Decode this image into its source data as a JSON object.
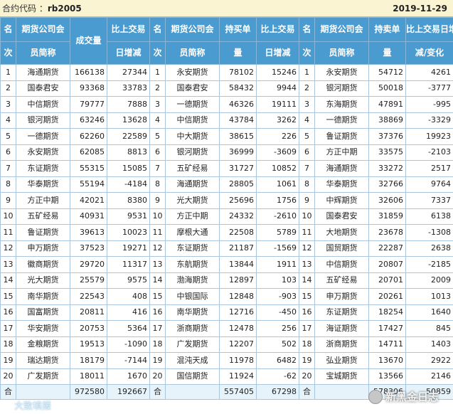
{
  "header": {
    "contract_label": "合约代码",
    "contract_code": "rb2005",
    "date": "2019-11-29"
  },
  "columns": {
    "rank": "名次",
    "member": "期货公司会员简称",
    "volume": "成交量",
    "volume_change": "比上交易日增减",
    "long_qty": "持买单量",
    "long_change": "比上交易日增减",
    "short_qty": "持卖单量",
    "short_change": "比上交易日增减/变化"
  },
  "rows": [
    [
      "1",
      "海通期货",
      "166138",
      "27344",
      "1",
      "永安期货",
      "78102",
      "15246",
      "1",
      "永安期货",
      "54712",
      "4261"
    ],
    [
      "2",
      "国泰君安",
      "93368",
      "33783",
      "2",
      "国泰君安",
      "58432",
      "9944",
      "2",
      "银河期货",
      "50018",
      "-3777"
    ],
    [
      "3",
      "中信期货",
      "79777",
      "7888",
      "3",
      "一德期货",
      "46326",
      "19111",
      "3",
      "东海期货",
      "47891",
      "-995"
    ],
    [
      "4",
      "银河期货",
      "63246",
      "13628",
      "4",
      "中信期货",
      "43784",
      "3262",
      "4",
      "一德期货",
      "38869",
      "-3329"
    ],
    [
      "5",
      "一德期货",
      "62260",
      "22589",
      "5",
      "中大期货",
      "38615",
      "226",
      "5",
      "鲁证期货",
      "37376",
      "19923"
    ],
    [
      "6",
      "永安期货",
      "62085",
      "8813",
      "6",
      "银河期货",
      "36999",
      "-3609",
      "6",
      "方正中期",
      "33575",
      "-2103"
    ],
    [
      "7",
      "东证期货",
      "55315",
      "15085",
      "7",
      "五矿经易",
      "31727",
      "10852",
      "7",
      "海通期货",
      "33272",
      "2517"
    ],
    [
      "8",
      "华泰期货",
      "55194",
      "-4184",
      "8",
      "海通期货",
      "28805",
      "1061",
      "8",
      "华泰期货",
      "32766",
      "9764"
    ],
    [
      "9",
      "方正中期",
      "42021",
      "8380",
      "9",
      "光大期货",
      "25696",
      "1756",
      "9",
      "中辉期货",
      "32606",
      "7337"
    ],
    [
      "10",
      "五矿经易",
      "40931",
      "9531",
      "10",
      "方正中期",
      "24332",
      "-2610",
      "10",
      "国泰君安",
      "31859",
      "6138"
    ],
    [
      "11",
      "鲁证期货",
      "39613",
      "10023",
      "11",
      "摩根大通",
      "22508",
      "5789",
      "11",
      "大地期货",
      "23678",
      "-1308"
    ],
    [
      "12",
      "申万期货",
      "37523",
      "19271",
      "12",
      "东证期货",
      "21187",
      "-1569",
      "12",
      "国贸期货",
      "22287",
      "2638"
    ],
    [
      "13",
      "徽商期货",
      "29720",
      "11317",
      "13",
      "东航期货",
      "13844",
      "1911",
      "13",
      "中信期货",
      "20807",
      "-2185"
    ],
    [
      "14",
      "光大期货",
      "25579",
      "9575",
      "14",
      "渤海期货",
      "12897",
      "103",
      "14",
      "五矿经易",
      "20701",
      "2009"
    ],
    [
      "15",
      "南华期货",
      "22543",
      "408",
      "15",
      "中银国际",
      "12848",
      "-903",
      "15",
      "申万期货",
      "20261",
      "1013"
    ],
    [
      "16",
      "国富期货",
      "20811",
      "416",
      "16",
      "南华期货",
      "12716",
      "-450",
      "16",
      "东证期货",
      "18254",
      "1640"
    ],
    [
      "17",
      "华安期货",
      "20753",
      "5364",
      "17",
      "浙商期货",
      "12478",
      "256",
      "17",
      "海证期货",
      "17427",
      "845"
    ],
    [
      "18",
      "金粮期货",
      "19513",
      "-1090",
      "18",
      "广发期货",
      "12207",
      "502",
      "18",
      "浙商期货",
      "14711",
      "1403"
    ],
    [
      "19",
      "瑞达期货",
      "18179",
      "-7144",
      "19",
      "混沌天成",
      "11978",
      "6482",
      "19",
      "弘业期货",
      "13670",
      "2922"
    ],
    [
      "20",
      "广发期货",
      "18011",
      "1670",
      "20",
      "国信期货",
      "11924",
      "-62",
      "20",
      "宝城期货",
      "13566",
      "2146"
    ]
  ],
  "totals": {
    "label": "合",
    "volume": "972580",
    "volume_change": "192667",
    "label2": "合",
    "long_qty": "557405",
    "long_change": "67298",
    "label3": "合",
    "short_qty": "578306",
    "short_change": "50859"
  },
  "watermarks": {
    "left": "大致填报",
    "right": "新黑金日志"
  }
}
